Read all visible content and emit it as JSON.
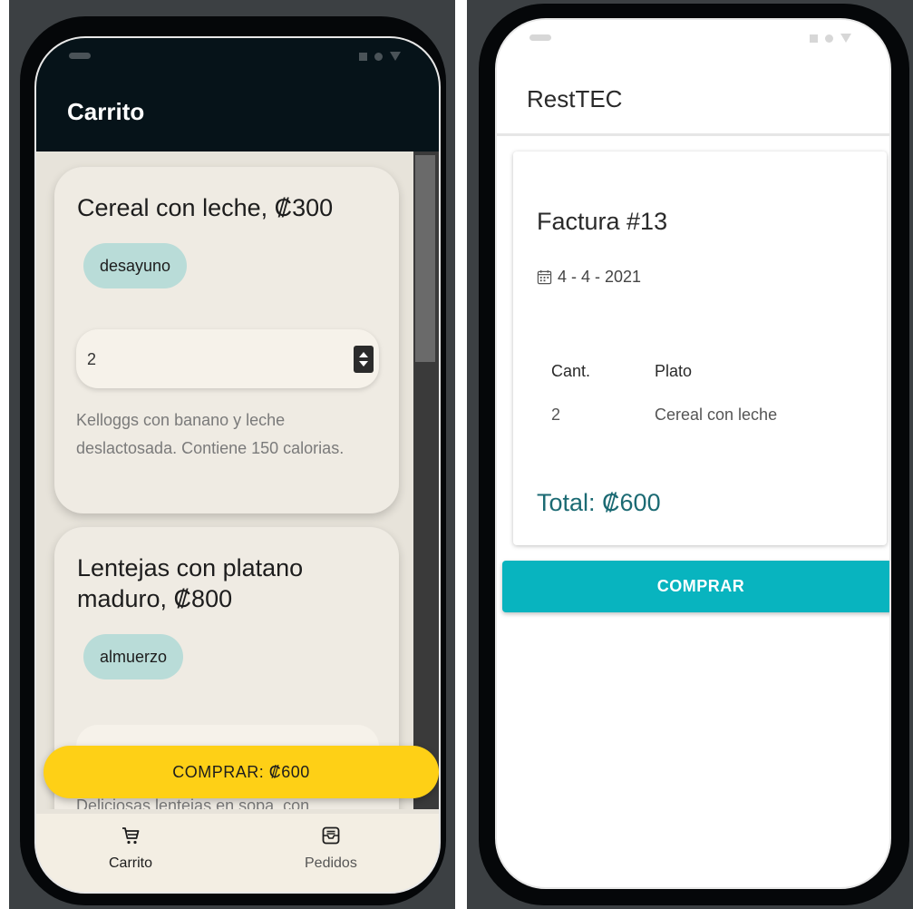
{
  "left_phone": {
    "title": "Carrito",
    "cards": [
      {
        "title": "Cereal con leche, ₡300",
        "tag": "desayuno",
        "quantity": "2",
        "description": "Kelloggs con banano y leche deslactosada. Contiene 150 calorias."
      },
      {
        "title": "Lentejas con platano maduro, ₡800",
        "tag": "almuerzo",
        "description_partial": "Deliciosas lentejas en sopa, con"
      }
    ],
    "buy_button": "COMPRAR: ₡600",
    "nav": {
      "carrito": "Carrito",
      "pedidos": "Pedidos",
      "carrito_icon": "cart-icon",
      "pedidos_icon": "inbox-icon"
    }
  },
  "right_phone": {
    "title": "RestTEC",
    "invoice": {
      "title": "Factura #13",
      "date": "4 - 4 - 2021",
      "date_icon": "calendar-icon",
      "columns": [
        "Cant.",
        "Plato"
      ],
      "rows": [
        [
          "2",
          "Cereal con leche"
        ]
      ],
      "total": "Total: ₡600"
    },
    "buy_button": "COMPRAR"
  },
  "colors": {
    "dark_appbar": "#061319",
    "yellow_button": "#fed016",
    "teal_button": "#08b4bf",
    "chip": "#b9dcd8",
    "total_text": "#1b6a73"
  }
}
